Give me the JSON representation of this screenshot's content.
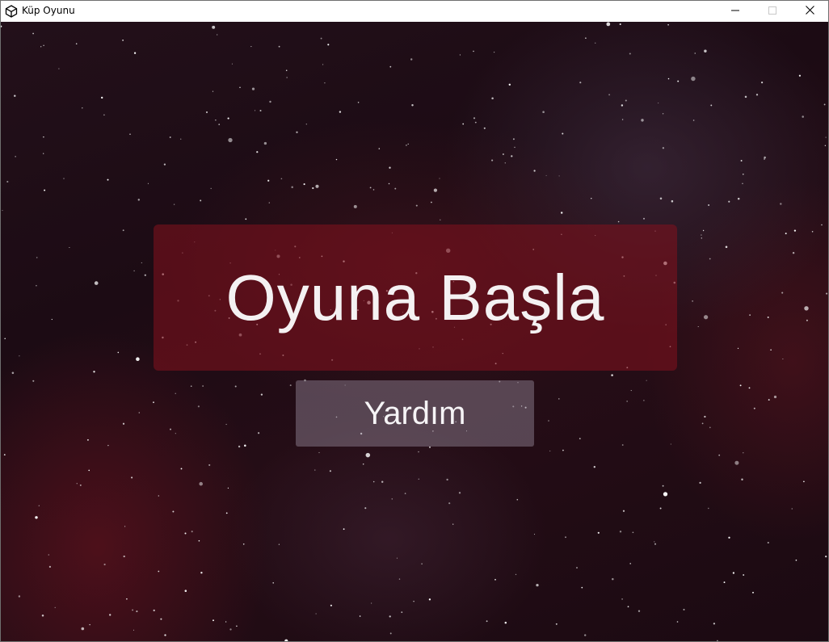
{
  "window": {
    "title": "Küp Oyunu",
    "icon": "unity-icon",
    "controls": [
      "minimize-icon",
      "maximize-icon",
      "close-icon"
    ]
  },
  "menu": {
    "start_label": "Oyuna Başla",
    "help_label": "Yardım"
  },
  "colors": {
    "background": "#1e0c15",
    "start_button": "#80121e",
    "help_button": "#968a9c",
    "text": "#f4f1f2"
  }
}
